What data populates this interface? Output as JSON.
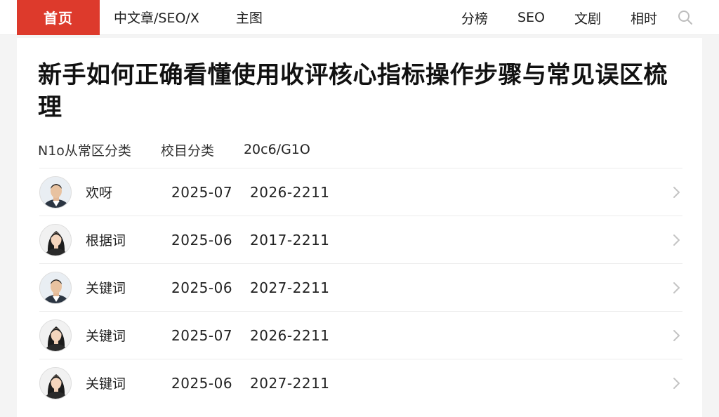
{
  "nav": {
    "home": "首页",
    "left": [
      "中文章/SEO/X",
      "主图"
    ],
    "right": [
      "分榜",
      "SEO",
      "文剧",
      "相时"
    ],
    "search_icon": "search-icon",
    "accent": "#dd3a2c"
  },
  "article": {
    "title": "新手如何正确看懂使用收评核心指标操作步骤与常见误区梳理",
    "meta": [
      "N1o从常区分类",
      "校目分类",
      "20c6/G1O"
    ]
  },
  "rows": [
    {
      "name": "欢呀",
      "date": "2025-07",
      "code": "2026-2211",
      "avatar": "male"
    },
    {
      "name": "根据词",
      "date": "2025-06",
      "code": "2017-2211",
      "avatar": "female"
    },
    {
      "name": "关键词",
      "date": "2025-06",
      "code": "2027-2211",
      "avatar": "male"
    },
    {
      "name": "关键词",
      "date": "2025-07",
      "code": "2026-2211",
      "avatar": "female"
    },
    {
      "name": "关键词",
      "date": "2025-06",
      "code": "2027-2211",
      "avatar": "female"
    }
  ]
}
